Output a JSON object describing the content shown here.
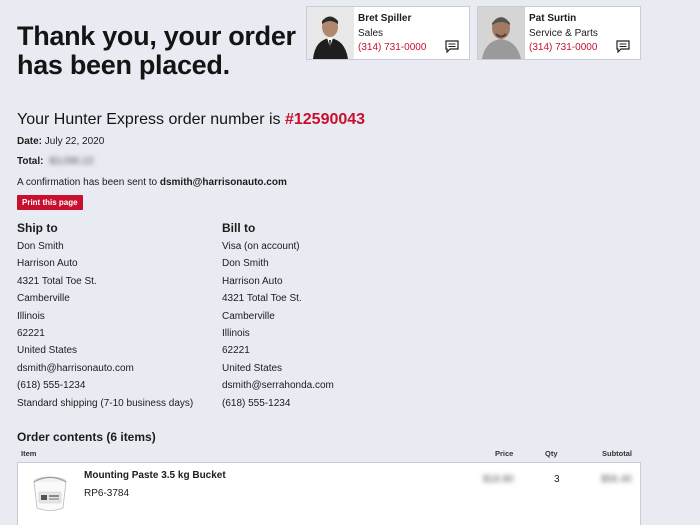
{
  "headline": "Thank you, your order has been placed.",
  "contacts": [
    {
      "name": "Bret Spiller",
      "role": "Sales",
      "phone": "(314) 731-0000",
      "icon": "message-icon"
    },
    {
      "name": "Pat Surtin",
      "role": "Service & Parts",
      "phone": "(314) 731-0000",
      "icon": "message-icon"
    }
  ],
  "order": {
    "prefix": "Your Hunter Express order number is",
    "number": "#12590043",
    "date_label": "Date:",
    "date": "July 22, 2020",
    "total_label": "Total:",
    "total": "$3,090.22",
    "confirmation_prefix": "A confirmation has been sent to",
    "confirmation_email": "dsmith@harrisonauto.com",
    "print_label": "Print this page"
  },
  "ship_to": {
    "title": "Ship to",
    "lines": [
      "Don Smith",
      "Harrison Auto",
      "4321 Total Toe St.",
      "Camberville",
      "Illinois",
      "62221",
      "United States",
      "dsmith@harrisonauto.com",
      "(618) 555-1234",
      "Standard shipping (7-10 business days)"
    ]
  },
  "bill_to": {
    "title": "Bill to",
    "lines": [
      "Visa (on account)",
      "Don Smith",
      "Harrison Auto",
      "4321 Total Toe St.",
      "Camberville",
      "Illinois",
      "62221",
      "United States",
      "dsmith@serrahonda.com",
      "(618) 555-1234"
    ]
  },
  "contents": {
    "title": "Order contents (6 items)",
    "columns": {
      "item": "Item",
      "price": "Price",
      "qty": "Qty",
      "subtotal": "Subtotal"
    },
    "rows": [
      {
        "name": "Mounting Paste 3.5 kg Bucket",
        "sku": "RP6-3784",
        "price": "$18.80",
        "qty": "3",
        "subtotal": "$56.40"
      }
    ]
  },
  "colors": {
    "accent": "#c8102e",
    "background": "#e9ebf3"
  }
}
